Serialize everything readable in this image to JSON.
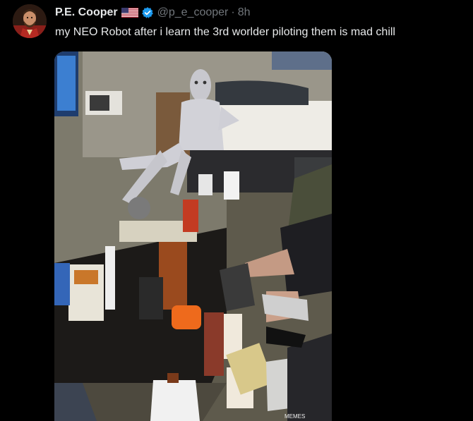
{
  "tweet": {
    "display_name": "P.E. Cooper",
    "handle": "@p_e_cooper",
    "separator": "·",
    "timestamp": "8h",
    "text": "my NEO Robot after i learn the 3rd worlder piloting them is mad chill",
    "flag_icon": "us-flag-icon",
    "verified_icon": "verified-badge-icon",
    "media_watermark": "MEMES"
  },
  "colors": {
    "background": "#000000",
    "primary_text": "#e7e9ea",
    "secondary_text": "#71767b",
    "verified_blue": "#1d9bf0"
  }
}
